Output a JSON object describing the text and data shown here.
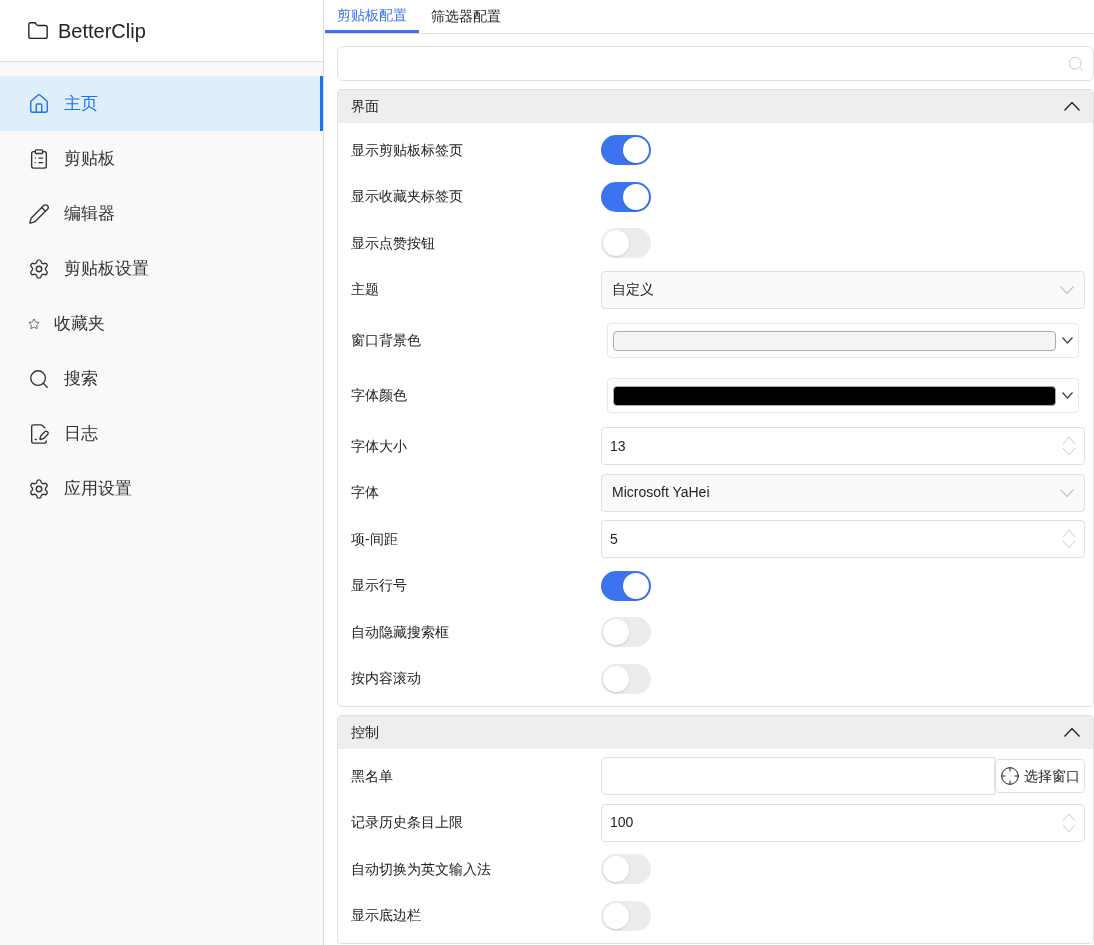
{
  "app": {
    "title": "BetterClip"
  },
  "sidebar": {
    "items": [
      {
        "label": "主页",
        "selected": true
      },
      {
        "label": "剪贴板",
        "selected": false
      },
      {
        "label": "编辑器",
        "selected": false
      },
      {
        "label": "剪贴板设置",
        "selected": false
      },
      {
        "label": "收藏夹",
        "selected": false
      },
      {
        "label": "搜索",
        "selected": false
      },
      {
        "label": "日志",
        "selected": false
      },
      {
        "label": "应用设置",
        "selected": false
      }
    ]
  },
  "tabs": [
    {
      "label": "剪贴板配置",
      "selected": true
    },
    {
      "label": "筛选器配置",
      "selected": false
    }
  ],
  "sections": [
    {
      "title": "界面",
      "expanded": true,
      "rows": [
        {
          "kind": "toggle",
          "label": "显示剪贴板标签页",
          "on": true
        },
        {
          "kind": "toggle",
          "label": "显示收藏夹标签页",
          "on": true
        },
        {
          "kind": "toggle",
          "label": "显示点赞按钮",
          "on": false
        },
        {
          "kind": "select",
          "label": "主题",
          "value": "自定义"
        },
        {
          "kind": "color",
          "label": "窗口背景色",
          "color": "#f5f5f5"
        },
        {
          "kind": "color",
          "label": "字体颜色",
          "color": "#000000"
        },
        {
          "kind": "number",
          "label": "字体大小",
          "value": "13"
        },
        {
          "kind": "select",
          "label": "字体",
          "value": "Microsoft YaHei"
        },
        {
          "kind": "number",
          "label": "项-间距",
          "value": "5"
        },
        {
          "kind": "toggle",
          "label": "显示行号",
          "on": true
        },
        {
          "kind": "toggle",
          "label": "自动隐藏搜索框",
          "on": false
        },
        {
          "kind": "toggle",
          "label": "按内容滚动",
          "on": false
        }
      ]
    },
    {
      "title": "控制",
      "expanded": true,
      "rows": [
        {
          "kind": "picker",
          "label": "黑名单",
          "button": "选择窗口"
        },
        {
          "kind": "number",
          "label": "记录历史条目上限",
          "value": "100"
        },
        {
          "kind": "toggle",
          "label": "自动切换为英文输入法",
          "on": false
        },
        {
          "kind": "toggle",
          "label": "显示底边栏",
          "on": false
        }
      ]
    }
  ]
}
